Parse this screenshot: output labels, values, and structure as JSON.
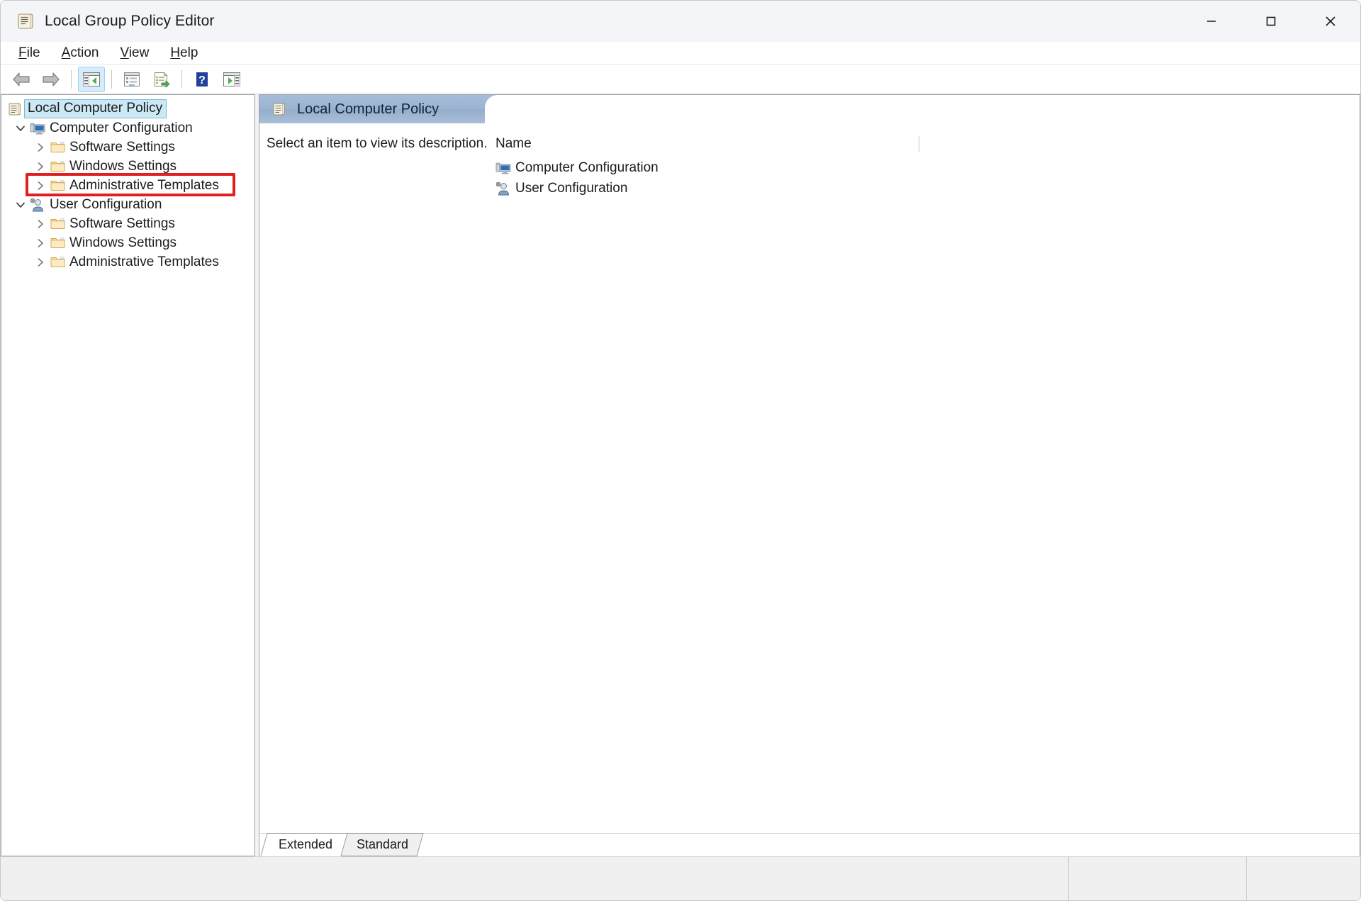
{
  "window": {
    "title": "Local Group Policy Editor",
    "title_icon": "policy-scroll-icon",
    "controls": {
      "minimize": "minimize-button",
      "maximize": "maximize-button",
      "close": "close-button"
    }
  },
  "menubar": {
    "items": [
      {
        "label": "File",
        "accel": "F"
      },
      {
        "label": "Action",
        "accel": "A"
      },
      {
        "label": "View",
        "accel": "V"
      },
      {
        "label": "Help",
        "accel": "H"
      }
    ]
  },
  "toolbar": {
    "buttons": [
      {
        "name": "back-button",
        "icon": "back-arrow-icon",
        "active": false
      },
      {
        "name": "forward-button",
        "icon": "forward-arrow-icon",
        "active": false
      },
      {
        "name": "separator-1",
        "icon": "separator",
        "active": false
      },
      {
        "name": "show-hide-console-tree-button",
        "icon": "console-tree-icon",
        "active": true
      },
      {
        "name": "separator-2",
        "icon": "separator",
        "active": false
      },
      {
        "name": "properties-button",
        "icon": "properties-icon",
        "active": false
      },
      {
        "name": "export-list-button",
        "icon": "export-list-icon",
        "active": false
      },
      {
        "name": "separator-3",
        "icon": "separator",
        "active": false
      },
      {
        "name": "help-button",
        "icon": "help-question-icon",
        "active": false
      },
      {
        "name": "show-action-pane-button",
        "icon": "action-pane-icon",
        "active": false
      }
    ]
  },
  "tree": {
    "root": {
      "label": "Local Computer Policy",
      "icon": "policy-scroll-icon",
      "selected": true
    },
    "nodes": [
      {
        "label": "Computer Configuration",
        "icon": "computer-icon",
        "expanded": true,
        "indent": 1,
        "twisty": "chevron-down",
        "highlighted": false
      },
      {
        "label": "Software Settings",
        "icon": "folder-icon",
        "expanded": false,
        "indent": 2,
        "twisty": "chevron-right",
        "highlighted": false
      },
      {
        "label": "Windows Settings",
        "icon": "folder-icon",
        "expanded": false,
        "indent": 2,
        "twisty": "chevron-right",
        "highlighted": false
      },
      {
        "label": "Administrative Templates",
        "icon": "folder-icon",
        "expanded": false,
        "indent": 2,
        "twisty": "chevron-right",
        "highlighted": true
      },
      {
        "label": "User Configuration",
        "icon": "user-icon",
        "expanded": true,
        "indent": 1,
        "twisty": "chevron-down",
        "highlighted": false
      },
      {
        "label": "Software Settings",
        "icon": "folder-icon",
        "expanded": false,
        "indent": 2,
        "twisty": "chevron-right",
        "highlighted": false
      },
      {
        "label": "Windows Settings",
        "icon": "folder-icon",
        "expanded": false,
        "indent": 2,
        "twisty": "chevron-right",
        "highlighted": false
      },
      {
        "label": "Administrative Templates",
        "icon": "folder-icon",
        "expanded": false,
        "indent": 2,
        "twisty": "chevron-right",
        "highlighted": false
      }
    ]
  },
  "right_pane": {
    "header": {
      "title": "Local Computer Policy",
      "icon": "policy-scroll-icon"
    },
    "description": "Select an item to view its description.",
    "list": {
      "column_header": "Name",
      "items": [
        {
          "label": "Computer Configuration",
          "icon": "computer-icon"
        },
        {
          "label": "User Configuration",
          "icon": "user-icon"
        }
      ]
    },
    "tabs": [
      {
        "label": "Extended",
        "active": true
      },
      {
        "label": "Standard",
        "active": false
      }
    ]
  },
  "statusbar": {
    "message": "",
    "segment_1": "",
    "segment_2": ""
  },
  "colors": {
    "highlight_red": "#e02020",
    "selection_blue": "#cce8f4",
    "header_blue": "#9cb4d2",
    "folder_yellow": "#ffd89b"
  }
}
